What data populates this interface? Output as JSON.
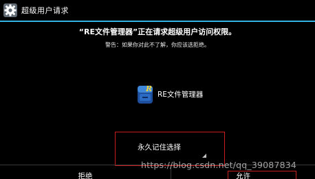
{
  "titlebar": {
    "title": "超级用户请求",
    "icon": "gear-icon"
  },
  "dialog": {
    "headline": "“RE文件管理器”正在请求超级用户访问权限。",
    "warning": "警告：如果你对此不了解，你应该选拒绝。",
    "app_name": "RE文件管理器",
    "app_icon": "re-file-manager-icon",
    "remember_choice": "永久记住选择"
  },
  "buttons": {
    "deny": "拒绝",
    "allow": "允许"
  },
  "watermark": "https://blog.csdn.net/qq_39087834",
  "colors": {
    "background": "#000000",
    "accent": "#33b5e5",
    "highlight_outline": "#c81e1e"
  }
}
